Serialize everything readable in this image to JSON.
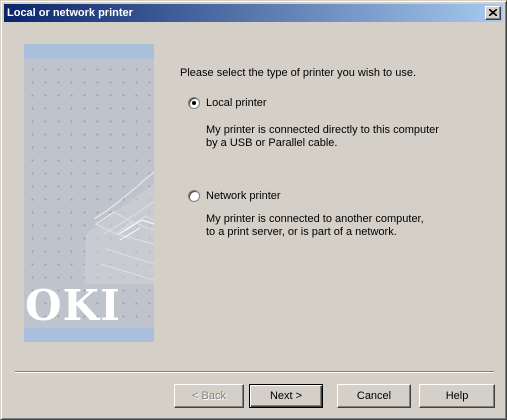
{
  "window": {
    "title": "Local or network printer",
    "close_icon": "close-icon"
  },
  "banner": {
    "logo_text": "OKI",
    "colors": {
      "stripe": "#a9bfdc",
      "background": "#bfc3cb"
    }
  },
  "main": {
    "prompt": "Please select the type of printer you wish to use.",
    "options": [
      {
        "label": "Local printer",
        "selected": true,
        "description_line1": "My printer is connected directly to this computer",
        "description_line2": "by a USB or Parallel cable."
      },
      {
        "label": "Network printer",
        "selected": false,
        "description_line1": "My printer is connected to another computer,",
        "description_line2": "to a print server, or is part of a network."
      }
    ]
  },
  "footer": {
    "back_label": "< Back",
    "next_label": "Next >",
    "cancel_label": "Cancel",
    "help_label": "Help"
  }
}
